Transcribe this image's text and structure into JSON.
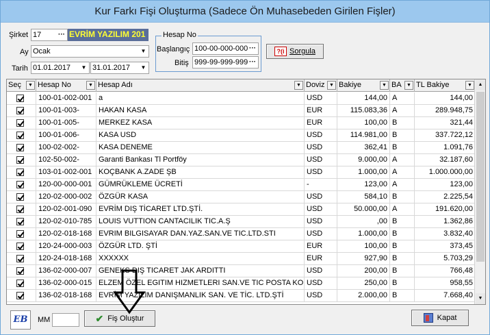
{
  "window": {
    "title": "Kur Farkı Fişi Oluşturma (Sadece Ön Muhasebeden Girilen Fişler)"
  },
  "form": {
    "sirket_label": "Şirket",
    "sirket_code": "17",
    "sirket_name": "EVRİM YAZILIM 201",
    "ay_label": "Ay",
    "ay_value": "Ocak",
    "tarih_label": "Tarih",
    "tarih_start": "01.01.2017",
    "tarih_end": "31.01.2017",
    "dots": "···",
    "dropdown_glyph": "▼"
  },
  "hesap_no": {
    "legend": "Hesap No",
    "baslangic_label": "Başlangıç",
    "baslangic_value": "100-00-000-000",
    "bitis_label": "Bitiş",
    "bitis_value": "999-99-999-999"
  },
  "sorgula": {
    "label": "Sorgula",
    "icon_text": "?(i"
  },
  "grid": {
    "columns": [
      "Seç",
      "Hesap No",
      "Hesap Adı",
      "Doviz",
      "Bakiye",
      "BA",
      "TL Bakiye"
    ],
    "rows": [
      [
        "100-01-002-001",
        "a",
        "USD",
        "144,00",
        "A",
        "144,00"
      ],
      [
        "100-01-003-",
        "HAKAN KASA",
        "EUR",
        "115.083,36",
        "A",
        "289.948,75"
      ],
      [
        "100-01-005-",
        "MERKEZ KASA",
        "EUR",
        "100,00",
        "B",
        "321,44"
      ],
      [
        "100-01-006-",
        "KASA USD",
        "USD",
        "114.981,00",
        "B",
        "337.722,12"
      ],
      [
        "100-02-002-",
        "KASA DENEME",
        "USD",
        "362,41",
        "B",
        "1.091,76"
      ],
      [
        "102-50-002-",
        "Garanti Bankası Tl Portföy",
        "USD",
        "9.000,00",
        "A",
        "32.187,60"
      ],
      [
        "103-01-002-001",
        "KOÇBANK A.ZADE ŞB",
        "USD",
        "1.000,00",
        "A",
        "1.000.000,00"
      ],
      [
        "120-00-000-001",
        "GÜMRÜKLEME ÜCRETİ",
        "-",
        "123,00",
        "A",
        "123,00"
      ],
      [
        "120-02-000-002",
        "ÖZGÜR KASA",
        "USD",
        "584,10",
        "B",
        "2.225,54"
      ],
      [
        "120-02-001-090",
        "EVRİM DIŞ TİCARET LTD.ŞTİ.",
        "USD",
        "50.000,00",
        "A",
        "191.620,00"
      ],
      [
        "120-02-010-785",
        "LOUIS VUTTION CANTACILIK TIC.A.Ş",
        "USD",
        ",00",
        "B",
        "1.362,86"
      ],
      [
        "120-02-018-168",
        "EVRIM BILGISAYAR DAN.YAZ.SAN.VE TIC.LTD.STI",
        "USD",
        "1.000,00",
        "B",
        "3.832,40"
      ],
      [
        "120-24-000-003",
        "ÖZGÜR LTD. ŞTİ",
        "EUR",
        "100,00",
        "B",
        "373,45"
      ],
      [
        "120-24-018-168",
        "XXXXXX",
        "EUR",
        "927,90",
        "B",
        "5.703,29"
      ],
      [
        "136-02-000-007",
        "GENEKS DIŞ TICARET JAK ARDITTI",
        "USD",
        "200,00",
        "B",
        "766,48"
      ],
      [
        "136-02-000-015",
        "ELZEM ÖZEL EGITIM HIZMETLERI SAN.VE TIC POSTA KOD",
        "USD",
        "250,00",
        "B",
        "958,55"
      ],
      [
        "136-02-018-168",
        "EVRİM YAZILIM DANIŞMANLIK SAN. VE TİC. LTD.ŞTİ",
        "USD",
        "2.000,00",
        "B",
        "7.668,40"
      ]
    ]
  },
  "footer": {
    "logo_text": "EB",
    "mm_label": "MM",
    "mm_value": "",
    "fis_olustur_label": "Fiş Oluştur",
    "kapat_label": "Kapat"
  }
}
